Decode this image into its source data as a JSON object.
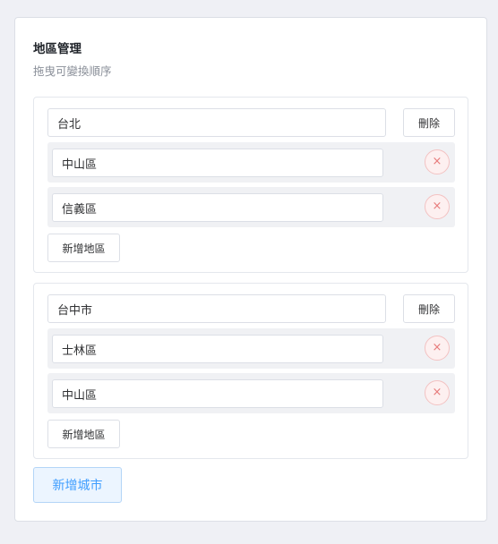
{
  "panel": {
    "title": "地區管理",
    "subtitle": "拖曳可變換順序"
  },
  "cities": [
    {
      "name": "台北",
      "delete_label": "刪除",
      "districts": [
        {
          "name": "中山區",
          "remove_icon": "×"
        },
        {
          "name": "信義區",
          "remove_icon": "×"
        }
      ],
      "add_district_label": "新增地區"
    },
    {
      "name": "台中市",
      "delete_label": "刪除",
      "districts": [
        {
          "name": "士林區",
          "remove_icon": "×"
        },
        {
          "name": "中山區",
          "remove_icon": "×"
        }
      ],
      "add_district_label": "新增地區"
    }
  ],
  "add_city_label": "新增城市",
  "colors": {
    "accent": "#409eff",
    "danger": "#e77a7a",
    "background": "#eff0f5"
  }
}
